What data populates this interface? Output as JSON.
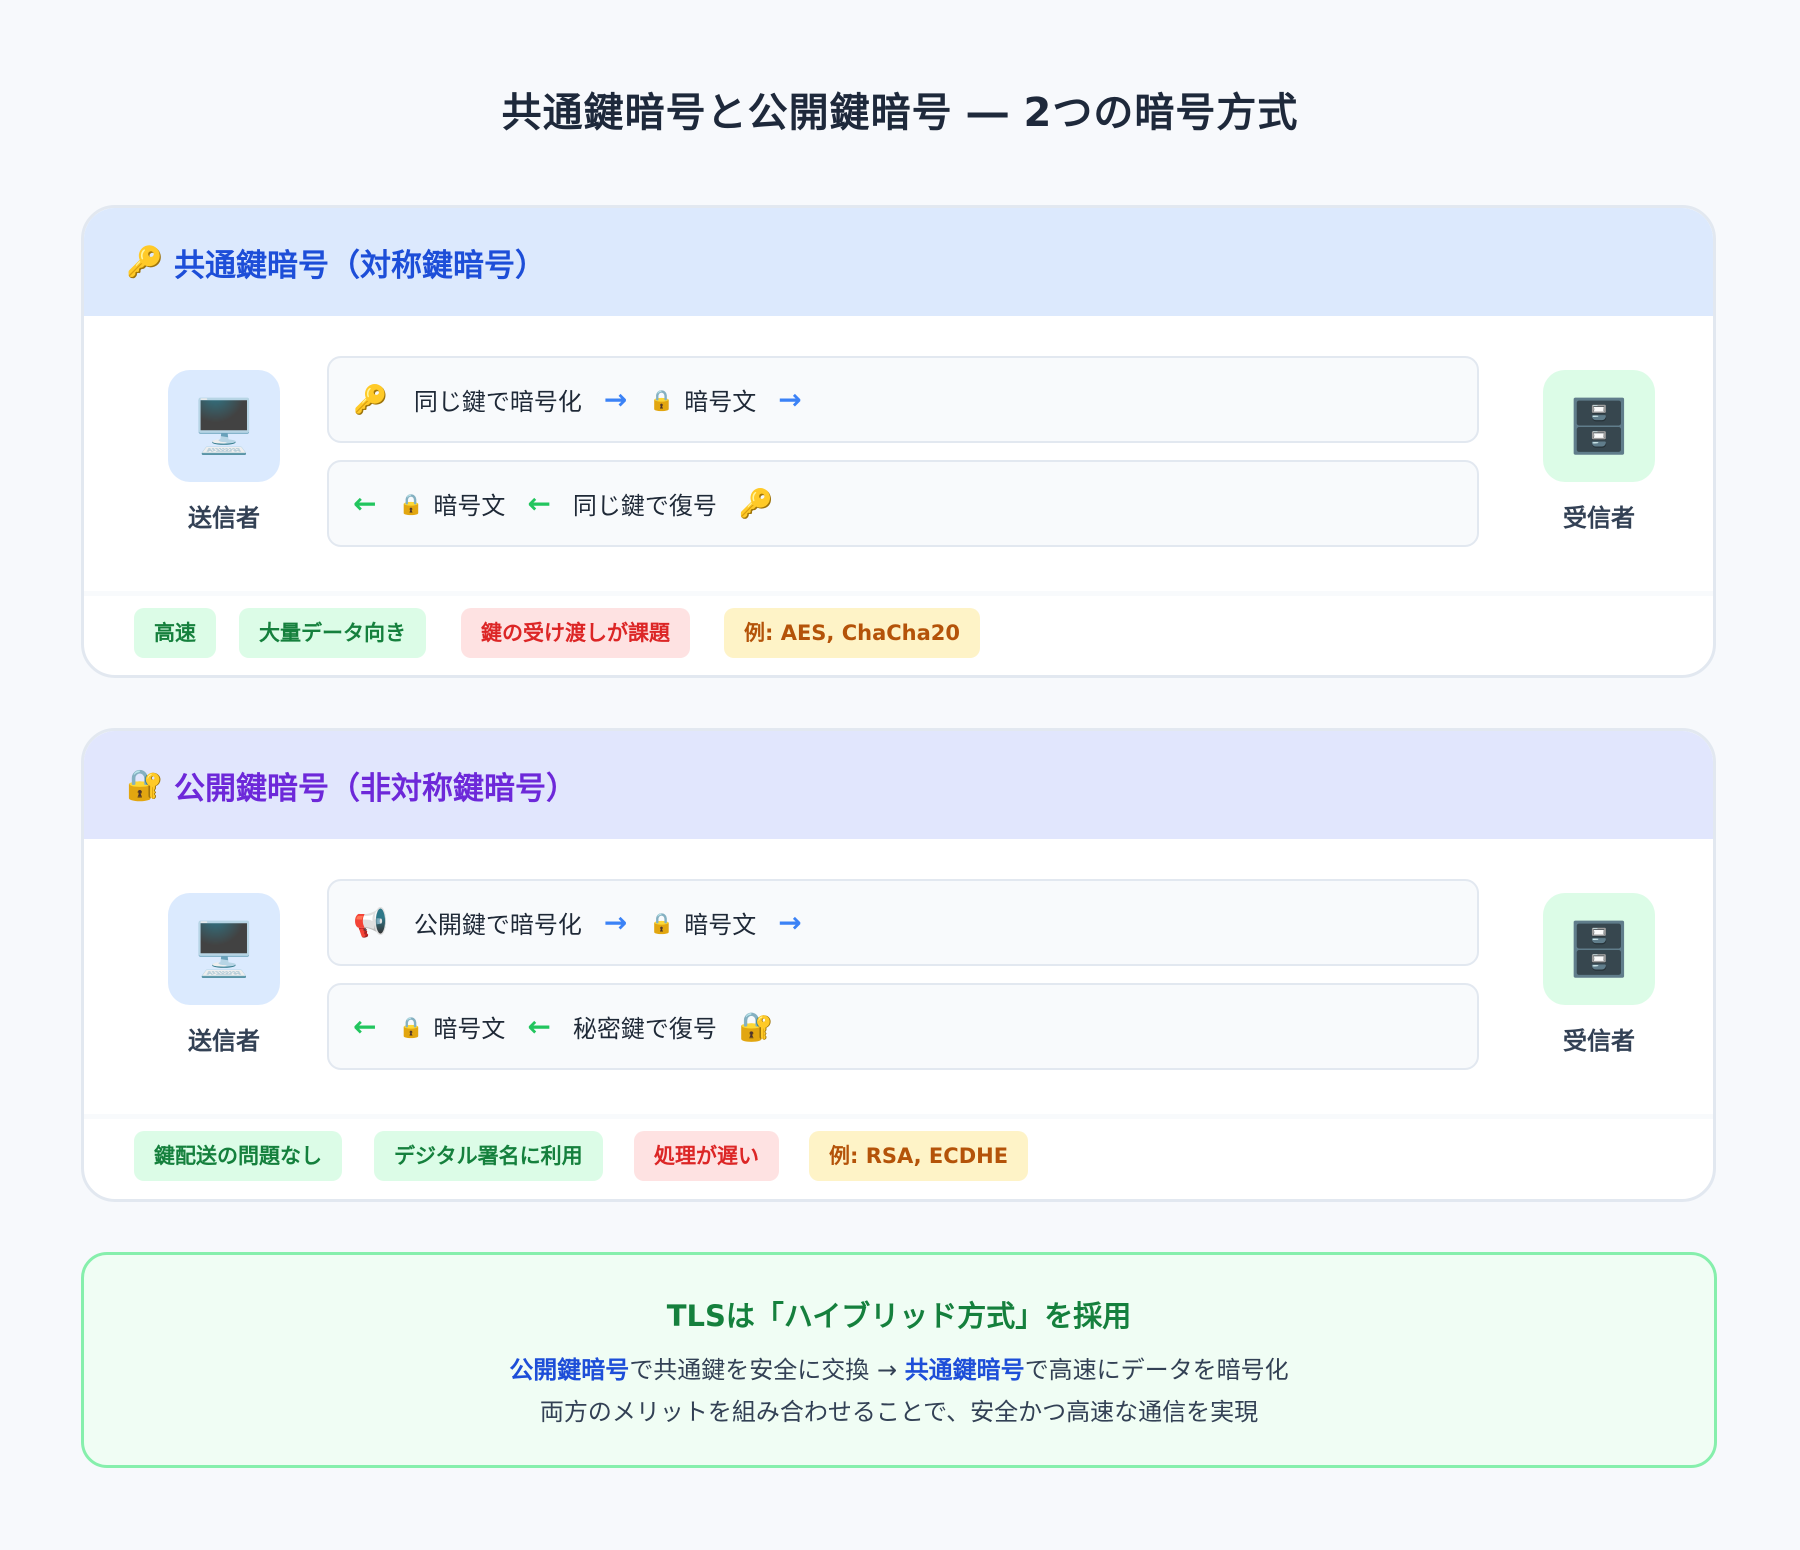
{
  "title": "共通鍵暗号と公開鍵暗号 ― 2つの暗号方式",
  "symmetric": {
    "header_icon": "key-icon",
    "title": "共通鍵暗号（対称鍵暗号）",
    "sender": {
      "icon": "computer-icon",
      "label": "送信者"
    },
    "receiver": {
      "icon": "file-cabinet-icon",
      "label": "受信者"
    },
    "flow_top": {
      "icon": "key-icon",
      "text1": "同じ鍵で暗号化",
      "arrow": "→",
      "lock_icon": "lock-icon",
      "text2": "暗号文"
    },
    "flow_bottom": {
      "arrow": "←",
      "lock_icon": "lock-icon",
      "text1": "暗号文",
      "text2": "同じ鍵で復号",
      "icon": "key-icon"
    },
    "tags": [
      {
        "label": "高速",
        "kind": "pro"
      },
      {
        "label": "大量データ向き",
        "kind": "pro"
      },
      {
        "label": "鍵の受け渡しが課題",
        "kind": "con"
      },
      {
        "label": "例: AES, ChaCha20",
        "kind": "example"
      }
    ]
  },
  "asymmetric": {
    "header_icon": "locked-with-key-icon",
    "title": "公開鍵暗号（非対称鍵暗号）",
    "sender": {
      "icon": "computer-icon",
      "label": "送信者"
    },
    "receiver": {
      "icon": "file-cabinet-icon",
      "label": "受信者"
    },
    "flow_top": {
      "icon": "megaphone-icon",
      "text1": "公開鍵で暗号化",
      "arrow": "→",
      "lock_icon": "lock-icon",
      "text2": "暗号文"
    },
    "flow_bottom": {
      "arrow": "←",
      "lock_icon": "lock-icon",
      "text1": "暗号文",
      "text2": "秘密鍵で復号",
      "icon": "locked-with-key-icon"
    },
    "tags": [
      {
        "label": "鍵配送の問題なし",
        "kind": "pro"
      },
      {
        "label": "デジタル署名に利用",
        "kind": "pro"
      },
      {
        "label": "処理が遅い",
        "kind": "con"
      },
      {
        "label": "例: RSA, ECDHE",
        "kind": "example"
      }
    ]
  },
  "summary": {
    "title": "TLSは「ハイブリッド方式」を採用",
    "line1_hl1": "公開鍵暗号",
    "line1_text1": "で共通鍵を安全に交換 → ",
    "line1_hl2": "共通鍵暗号",
    "line1_text2": "で高速にデータを暗号化",
    "line2": "両方のメリットを組み合わせることで、安全かつ高速な通信を実現"
  },
  "colors": {
    "symmetric_accent": "#1d4ed8",
    "asymmetric_accent": "#6d28d9",
    "forward_arrow": "#3b82f6",
    "return_arrow": "#22c55e",
    "pro_tag": "#15803d",
    "con_tag": "#dc2626",
    "example_tag": "#b45309",
    "summary_accent": "#15803d"
  }
}
